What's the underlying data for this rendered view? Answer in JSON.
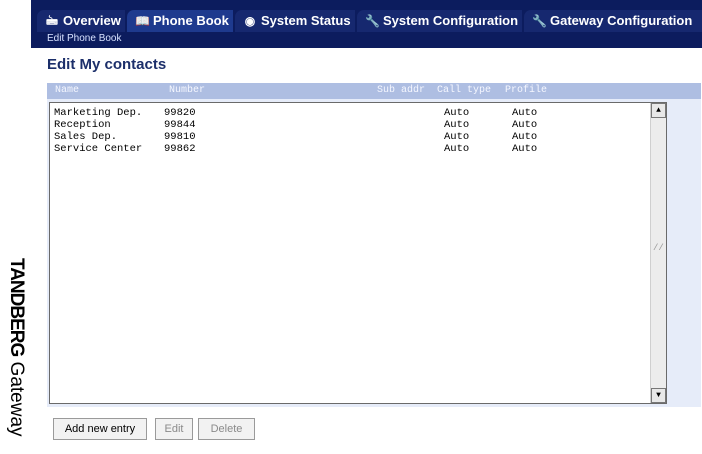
{
  "brand": {
    "name_bold": "TANDBERG",
    "name_regular": " Gateway"
  },
  "tabs": [
    {
      "label": "Overview",
      "icon": "overview-icon",
      "glyph": "🖮"
    },
    {
      "label": "Phone Book",
      "icon": "book-icon",
      "glyph": "📖"
    },
    {
      "label": "System Status",
      "icon": "status-icon",
      "glyph": "◉"
    },
    {
      "label": "System Configuration",
      "icon": "wrench-icon",
      "glyph": "🔧"
    },
    {
      "label": "Gateway Configuration",
      "icon": "wrench-icon",
      "glyph": "🔧"
    }
  ],
  "active_tab": "Phone Book",
  "subtab": "Edit Phone Book",
  "page_title": "Edit My contacts",
  "columns": [
    "Name",
    "Number",
    "Sub addr",
    "Call type",
    "Profile"
  ],
  "contacts": [
    {
      "name": "Marketing Dep.",
      "number": "99820",
      "sub_addr": "",
      "call_type": "Auto",
      "profile": "Auto"
    },
    {
      "name": "Reception",
      "number": "99844",
      "sub_addr": "",
      "call_type": "Auto",
      "profile": "Auto"
    },
    {
      "name": "Sales Dep.",
      "number": "99810",
      "sub_addr": "",
      "call_type": "Auto",
      "profile": "Auto"
    },
    {
      "name": "Service Center",
      "number": "99862",
      "sub_addr": "",
      "call_type": "Auto",
      "profile": "Auto"
    }
  ],
  "buttons": {
    "add": "Add new entry",
    "edit": "Edit",
    "delete": "Delete"
  },
  "colors": {
    "header_bg": "#0c1c5e",
    "tab_bg": "#16286f",
    "title": "#1c2f6a",
    "grid_header": "#aebee2"
  }
}
